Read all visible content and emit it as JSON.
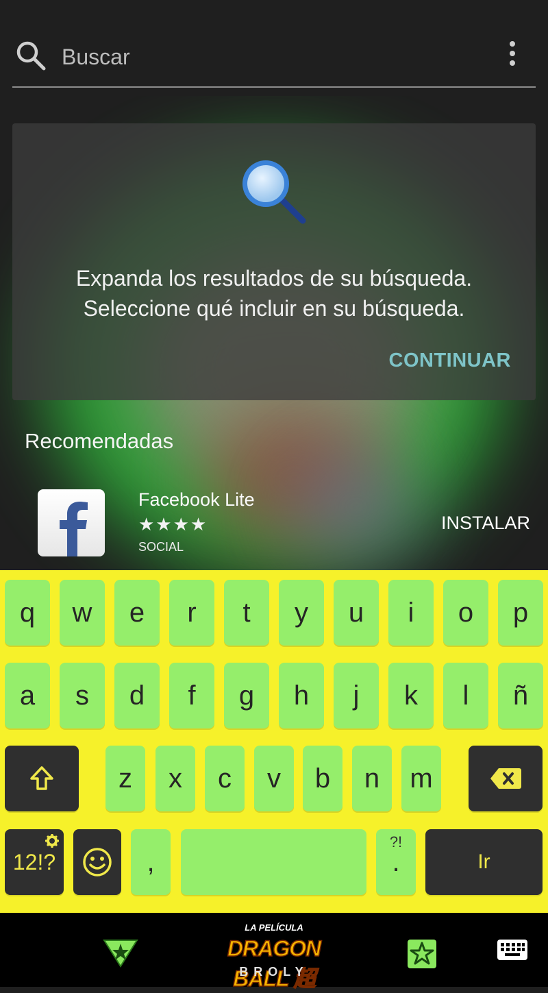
{
  "search": {
    "placeholder": "Buscar"
  },
  "expand_card": {
    "line1": "Expanda los resultados de su búsqueda.",
    "line2": "Seleccione qué incluir en su búsqueda.",
    "continue_label": "CONTINUAR"
  },
  "recommended": {
    "title": "Recomendadas",
    "app": {
      "name": "Facebook Lite",
      "stars": "★★★★",
      "category": "SOCIAL",
      "install_label": "INSTALAR"
    }
  },
  "keyboard": {
    "row1": [
      "q",
      "w",
      "e",
      "r",
      "t",
      "y",
      "u",
      "i",
      "o",
      "p"
    ],
    "row2": [
      "a",
      "s",
      "d",
      "f",
      "g",
      "h",
      "j",
      "k",
      "l",
      "ñ"
    ],
    "row3": [
      "z",
      "x",
      "c",
      "v",
      "b",
      "n",
      "m"
    ],
    "symbols_label": "12!?",
    "comma": ",",
    "period": ".",
    "period_hint": "?!",
    "enter_label": "Ir"
  },
  "nav_bar": {
    "logo_sub": "LA PELÍCULA",
    "logo_main": "DRAGON BALL 超",
    "logo_broly": "BROLY"
  },
  "colors": {
    "keyboard_bg": "#f6f12a",
    "key_bg": "#95ee6b",
    "dark_key_bg": "#2f2f2f",
    "accent": "#7ec4c8"
  }
}
